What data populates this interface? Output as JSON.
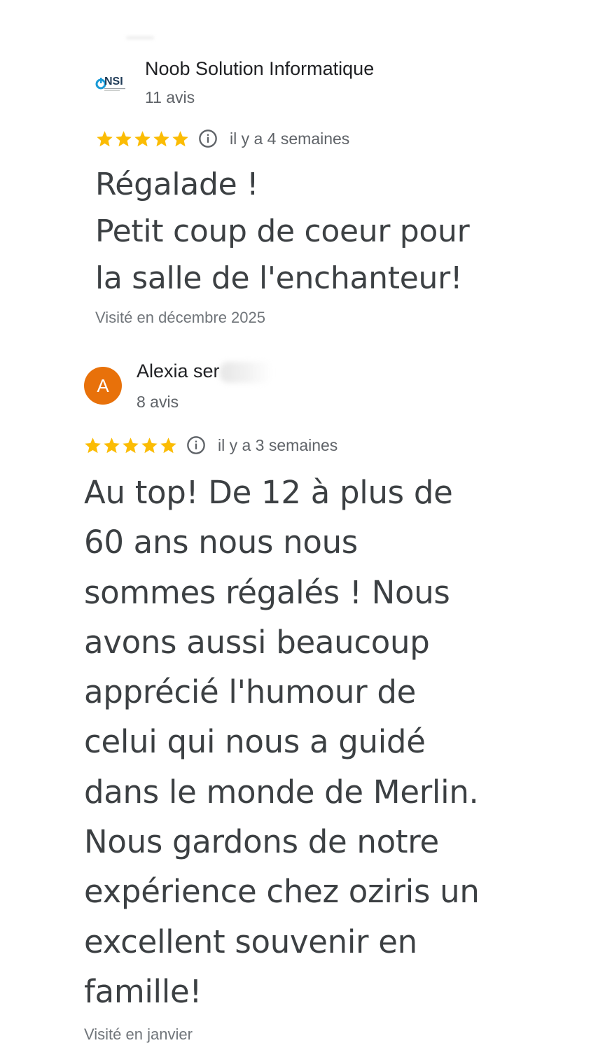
{
  "reviews": [
    {
      "author": "Noob Solution Informatique",
      "avatar_type": "logo",
      "avatar_logo_text": "NSI",
      "review_count": "11 avis",
      "rating": 5,
      "date": "il y a 4 semaines",
      "text": "Régalade !\nPetit coup de coeur pour\nla salle de l'enchanteur!",
      "visit": "Visité en décembre 2025"
    },
    {
      "author": "Alexia ser",
      "avatar_type": "letter",
      "avatar_letter": "A",
      "avatar_color": "#e8710a",
      "review_count": "8 avis",
      "rating": 5,
      "date": "il y a 3 semaines",
      "text": "Au top! De 12 à plus de\n60 ans nous nous\nsommes régalés ! Nous\navons aussi beaucoup\napprécié l'humour de\ncelui qui nous a guidé\ndans le monde de Merlin.\nNous gardons de notre\nexpérience chez oziris un\nexcellent souvenir en\nfamille!",
      "visit": "Visité en janvier"
    }
  ],
  "colors": {
    "star": "#fbbc04",
    "logo_dark": "#1f3b57",
    "logo_accent": "#1a9ad6"
  },
  "icons": {
    "star": "star-icon",
    "info": "info-icon"
  }
}
